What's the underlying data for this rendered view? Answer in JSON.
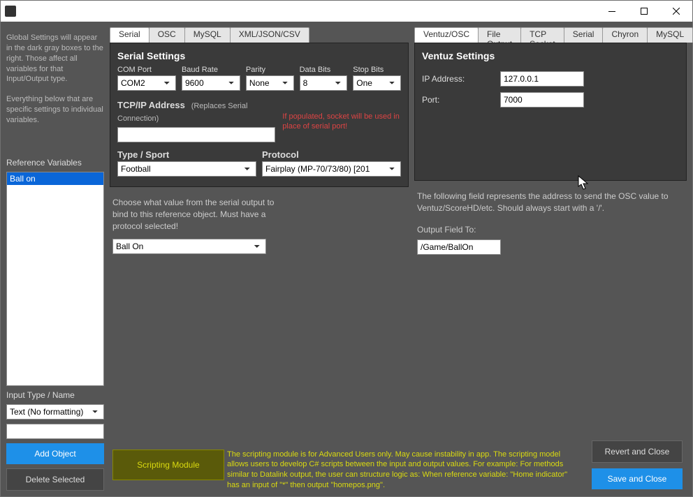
{
  "titlebar": {
    "title": ""
  },
  "global_settings_text1": "Global Settings will appear in the dark gray boxes to the right. Those affect all variables for that Input/Output type.",
  "global_settings_text2": "Everything below that are specific settings to individual variables.",
  "ref_vars_label": "Reference Variables",
  "ref_vars": [
    "Ball on"
  ],
  "input_type_label": "Input Type / Name",
  "input_type_value": "Text (No formatting)",
  "new_name_value": "",
  "add_object_label": "Add Object",
  "delete_selected_label": "Delete Selected",
  "input_tabs": [
    "Serial",
    "OSC",
    "MySQL",
    "XML/JSON/CSV"
  ],
  "input_tab_active": 0,
  "serial": {
    "heading": "Serial Settings",
    "com_port_label": "COM Port",
    "com_port_value": "COM2",
    "baud_label": "Baud Rate",
    "baud_value": "9600",
    "parity_label": "Parity",
    "parity_value": "None",
    "data_bits_label": "Data Bits",
    "data_bits_value": "8",
    "stop_bits_label": "Stop Bits",
    "stop_bits_value": "One",
    "tcp_heading": "TCP/IP Address",
    "tcp_sub": "(Replaces Serial Connection)",
    "tcp_value": "",
    "tcp_warn": "If populated, socket will be used in place of serial port!",
    "type_label": "Type / Sport",
    "type_value": "Football",
    "protocol_label": "Protocol",
    "protocol_value": "Fairplay (MP-70/73/80) [201",
    "bind_help": "Choose what value from the serial output to bind to this reference object. Must have a protocol selected!",
    "bind_value": "Ball On"
  },
  "output_tabs": [
    "Ventuz/OSC",
    "File Output",
    "TCP Socket",
    "Serial",
    "Chyron",
    "MySQL"
  ],
  "output_tab_active": 0,
  "ventuz": {
    "heading": "Ventuz Settings",
    "ip_label": "IP Address:",
    "ip_value": "127.0.0.1",
    "port_label": "Port:",
    "port_value": "7000",
    "field_help": "The following field represents the address to send the OSC value to Ventuz/ScoreHD/etc. Should always start with a '/'.",
    "output_field_label": "Output Field To:",
    "output_field_value": "/Game/BallOn"
  },
  "scripting": {
    "button": "Scripting Module",
    "text": "The scripting module is for Advanced Users only. May cause instability in app. The scripting model allows users to develop C# scripts between the input and output values. For example: For methods similar to Datalink output, the user can structure logic as: When reference variable: \"Home indicator\" has an input of \"*\" then output \"homepos.png\"."
  },
  "revert_label": "Revert and Close",
  "save_label": "Save and Close"
}
